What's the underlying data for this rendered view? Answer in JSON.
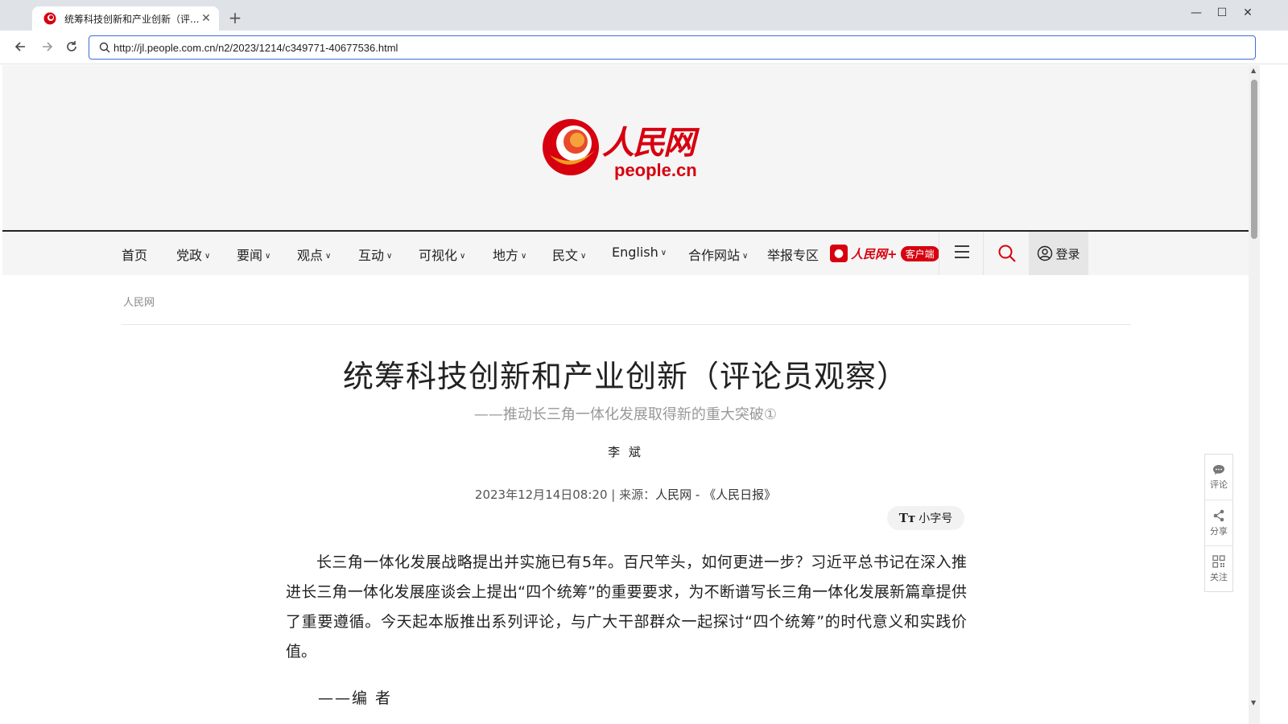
{
  "browser": {
    "tab_title": "统筹科技创新和产业创新（评...",
    "url": "http://jl.people.com.cn/n2/2023/1214/c349771-40677536.html",
    "icons": [
      "favicon-icon",
      "close-icon",
      "plus-icon",
      "minimize-icon",
      "maximize-icon",
      "window-close-icon",
      "back-icon",
      "forward-icon",
      "reload-icon",
      "search-icon"
    ]
  },
  "site": {
    "logo_cn": "人民网",
    "logo_en": "people.cn",
    "brand_color": "#d7000f"
  },
  "nav": {
    "items": [
      {
        "label": "首页",
        "dropdown": false
      },
      {
        "label": "党政",
        "dropdown": true
      },
      {
        "label": "要闻",
        "dropdown": true
      },
      {
        "label": "观点",
        "dropdown": true
      },
      {
        "label": "互动",
        "dropdown": true
      },
      {
        "label": "可视化",
        "dropdown": true
      },
      {
        "label": "地方",
        "dropdown": true
      },
      {
        "label": "民文",
        "dropdown": true
      },
      {
        "label": "English",
        "dropdown": true
      },
      {
        "label": "合作网站",
        "dropdown": true
      },
      {
        "label": "举报专区",
        "dropdown": false
      }
    ],
    "app_name": "人民网+",
    "app_tag": "客户端",
    "login": "登录"
  },
  "breadcrumb": "人民网",
  "article": {
    "title": "统筹科技创新和产业创新（评论员观察）",
    "subtitle": "——推动长三角一体化发展取得新的重大突破①",
    "author": "李 斌",
    "date": "2023年12月14日08:20",
    "source_sep": "|",
    "source_label": "来源：",
    "source": "人民网 - 《人民日报》",
    "font_toggle": "小字号",
    "font_toggle_icon": "Tт",
    "paragraph": "长三角一体化发展战略提出并实施已有5年。百尺竿头，如何更进一步？习近平总书记在深入推进长三角一体化发展座谈会上提出“四个统筹”的重要要求，为不断谱写长三角一体化发展新篇章提供了重要遵循。今天起本版推出系列评论，与广大干部群众一起探讨“四个统筹”的时代意义和实践价值。",
    "editor_note": "——编  者"
  },
  "side_panel": [
    {
      "label": "评论",
      "icon": "comment-icon"
    },
    {
      "label": "分享",
      "icon": "share-icon"
    },
    {
      "label": "关注",
      "icon": "qrcode-icon"
    }
  ]
}
